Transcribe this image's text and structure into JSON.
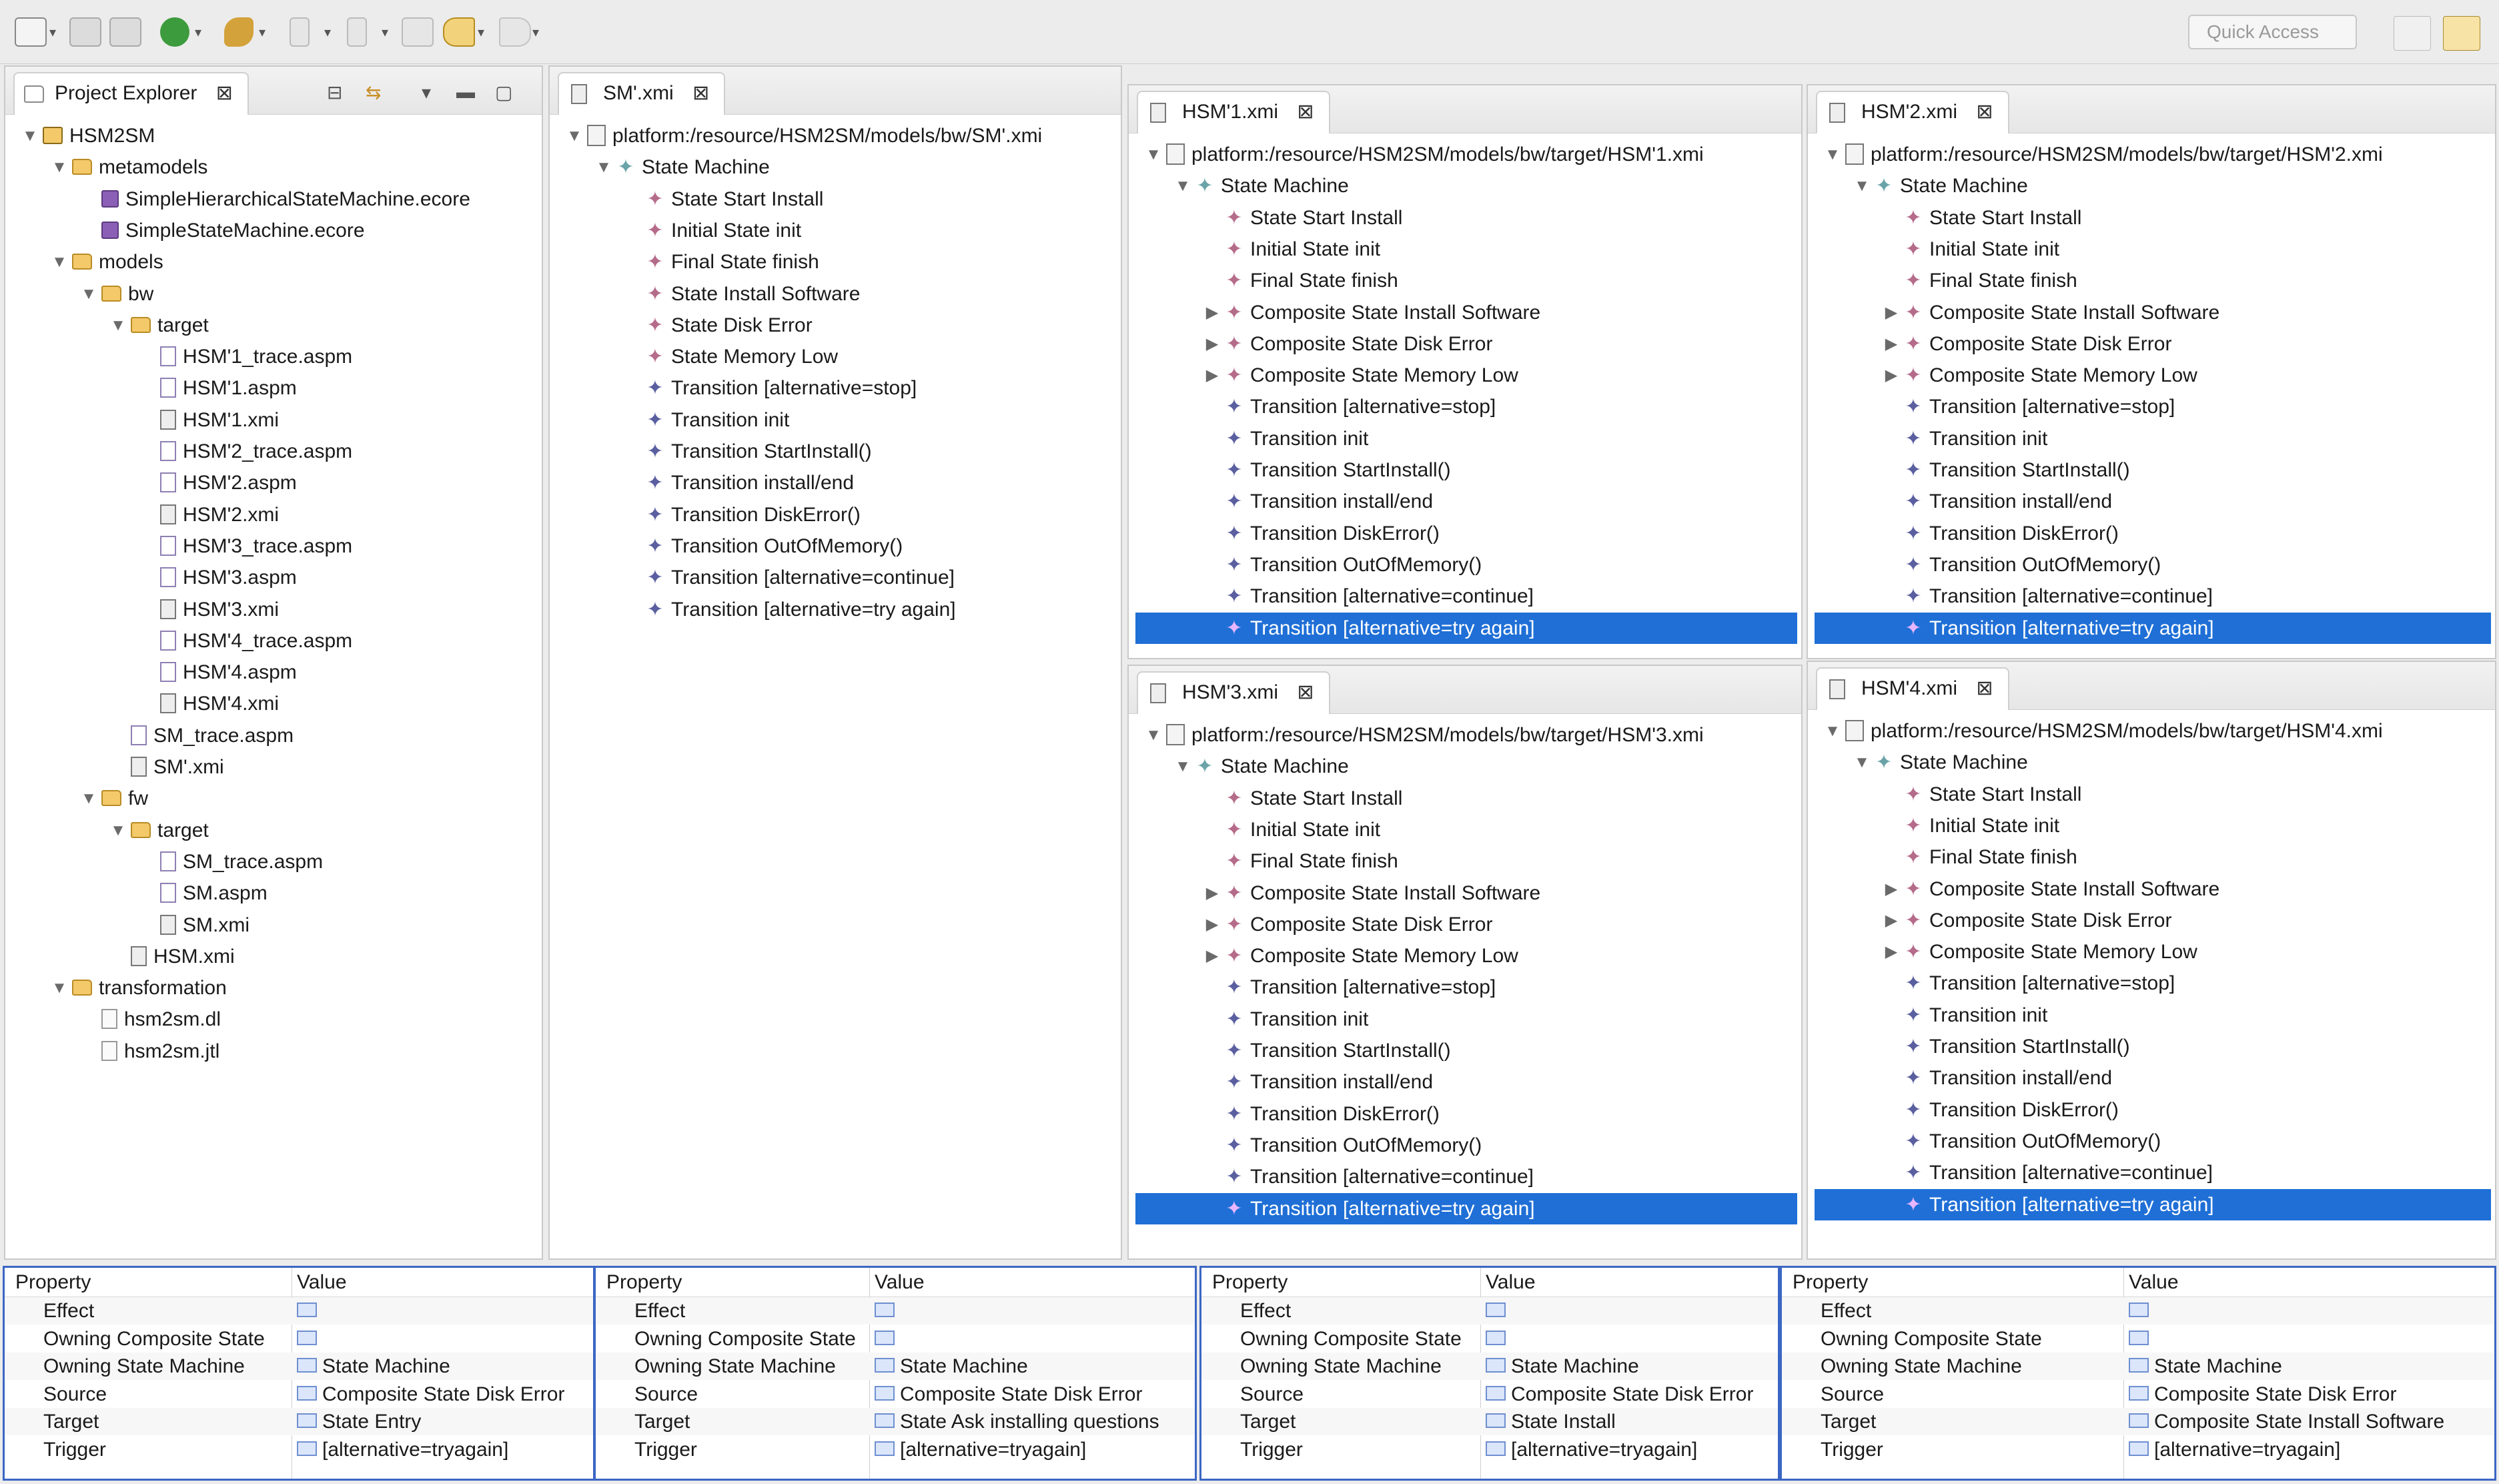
{
  "toolbar": {
    "quick_access_placeholder": "Quick Access"
  },
  "project_explorer": {
    "title": "Project Explorer",
    "items": [
      {
        "label": "HSM2SM",
        "icon": "project-folder-icon",
        "depth": 0,
        "expanded": true
      },
      {
        "label": "metamodels",
        "icon": "folder-icon",
        "depth": 1,
        "expanded": true
      },
      {
        "label": "SimpleHierarchicalStateMachine.ecore",
        "icon": "ecore-file-icon",
        "depth": 2
      },
      {
        "label": "SimpleStateMachine.ecore",
        "icon": "ecore-file-icon",
        "depth": 2
      },
      {
        "label": "models",
        "icon": "folder-icon",
        "depth": 1,
        "expanded": true
      },
      {
        "label": "bw",
        "icon": "folder-icon",
        "depth": 2,
        "expanded": true
      },
      {
        "label": "target",
        "icon": "folder-icon",
        "depth": 3,
        "expanded": true
      },
      {
        "label": "HSM'1_trace.aspm",
        "icon": "aspm-file-icon",
        "depth": 4
      },
      {
        "label": "HSM'1.aspm",
        "icon": "aspm-file-icon",
        "depth": 4
      },
      {
        "label": "HSM'1.xmi",
        "icon": "xmi-file-icon",
        "depth": 4
      },
      {
        "label": "HSM'2_trace.aspm",
        "icon": "aspm-file-icon",
        "depth": 4
      },
      {
        "label": "HSM'2.aspm",
        "icon": "aspm-file-icon",
        "depth": 4
      },
      {
        "label": "HSM'2.xmi",
        "icon": "xmi-file-icon",
        "depth": 4
      },
      {
        "label": "HSM'3_trace.aspm",
        "icon": "aspm-file-icon",
        "depth": 4
      },
      {
        "label": "HSM'3.aspm",
        "icon": "aspm-file-icon",
        "depth": 4
      },
      {
        "label": "HSM'3.xmi",
        "icon": "xmi-file-icon",
        "depth": 4
      },
      {
        "label": "HSM'4_trace.aspm",
        "icon": "aspm-file-icon",
        "depth": 4
      },
      {
        "label": "HSM'4.aspm",
        "icon": "aspm-file-icon",
        "depth": 4
      },
      {
        "label": "HSM'4.xmi",
        "icon": "xmi-file-icon",
        "depth": 4
      },
      {
        "label": "SM_trace.aspm",
        "icon": "aspm-file-icon",
        "depth": 3
      },
      {
        "label": "SM'.xmi",
        "icon": "xmi-file-icon",
        "depth": 3
      },
      {
        "label": "fw",
        "icon": "folder-icon",
        "depth": 2,
        "expanded": true
      },
      {
        "label": "target",
        "icon": "folder-icon",
        "depth": 3,
        "expanded": true
      },
      {
        "label": "SM_trace.aspm",
        "icon": "aspm-file-icon",
        "depth": 4
      },
      {
        "label": "SM.aspm",
        "icon": "aspm-file-icon",
        "depth": 4
      },
      {
        "label": "SM.xmi",
        "icon": "xmi-file-icon",
        "depth": 4
      },
      {
        "label": "HSM.xmi",
        "icon": "xmi-file-icon",
        "depth": 3
      },
      {
        "label": "transformation",
        "icon": "folder-icon",
        "depth": 1,
        "expanded": true
      },
      {
        "label": "hsm2sm.dl",
        "icon": "text-file-icon",
        "depth": 2
      },
      {
        "label": "hsm2sm.jtl",
        "icon": "text-file-icon",
        "depth": 2
      }
    ]
  },
  "editors": {
    "sm": {
      "tab_label": "SM'.xmi",
      "resource": "platform:/resource/HSM2SM/models/bw/SM'.xmi",
      "root": "State Machine",
      "items": [
        {
          "label": "State Start Install",
          "kind": "state"
        },
        {
          "label": "Initial State init",
          "kind": "state"
        },
        {
          "label": "Final State finish",
          "kind": "state"
        },
        {
          "label": "State Install Software",
          "kind": "state"
        },
        {
          "label": "State Disk Error",
          "kind": "state"
        },
        {
          "label": "State Memory Low",
          "kind": "state"
        },
        {
          "label": "Transition [alternative=stop]",
          "kind": "trans"
        },
        {
          "label": "Transition init",
          "kind": "trans"
        },
        {
          "label": "Transition StartInstall()",
          "kind": "trans"
        },
        {
          "label": "Transition install/end",
          "kind": "trans"
        },
        {
          "label": "Transition DiskError()",
          "kind": "trans"
        },
        {
          "label": "Transition OutOfMemory()",
          "kind": "trans"
        },
        {
          "label": "Transition [alternative=continue]",
          "kind": "trans"
        },
        {
          "label": "Transition [alternative=try again]",
          "kind": "trans"
        }
      ]
    },
    "hsm1": {
      "tab_label": "HSM'1.xmi",
      "resource": "platform:/resource/HSM2SM/models/bw/target/HSM'1.xmi",
      "root": "State Machine",
      "items": [
        {
          "label": "State Start Install",
          "kind": "state"
        },
        {
          "label": "Initial State init",
          "kind": "state"
        },
        {
          "label": "Final State finish",
          "kind": "state"
        },
        {
          "label": "Composite State Install Software",
          "kind": "state",
          "collapsed": true
        },
        {
          "label": "Composite State Disk Error",
          "kind": "state",
          "collapsed": true
        },
        {
          "label": "Composite State Memory Low",
          "kind": "state",
          "collapsed": true
        },
        {
          "label": "Transition [alternative=stop]",
          "kind": "trans"
        },
        {
          "label": "Transition init",
          "kind": "trans"
        },
        {
          "label": "Transition StartInstall()",
          "kind": "trans"
        },
        {
          "label": "Transition install/end",
          "kind": "trans"
        },
        {
          "label": "Transition DiskError()",
          "kind": "trans"
        },
        {
          "label": "Transition OutOfMemory()",
          "kind": "trans"
        },
        {
          "label": "Transition [alternative=continue]",
          "kind": "trans"
        },
        {
          "label": "Transition [alternative=try again]",
          "kind": "trans",
          "selected": true
        }
      ]
    },
    "hsm2": {
      "tab_label": "HSM'2.xmi",
      "resource": "platform:/resource/HSM2SM/models/bw/target/HSM'2.xmi",
      "root": "State Machine",
      "items": [
        {
          "label": "State Start Install",
          "kind": "state"
        },
        {
          "label": "Initial State init",
          "kind": "state"
        },
        {
          "label": "Final State finish",
          "kind": "state"
        },
        {
          "label": "Composite State Install Software",
          "kind": "state",
          "collapsed": true
        },
        {
          "label": "Composite State Disk Error",
          "kind": "state",
          "collapsed": true
        },
        {
          "label": "Composite State Memory Low",
          "kind": "state",
          "collapsed": true
        },
        {
          "label": "Transition [alternative=stop]",
          "kind": "trans"
        },
        {
          "label": "Transition init",
          "kind": "trans"
        },
        {
          "label": "Transition StartInstall()",
          "kind": "trans"
        },
        {
          "label": "Transition install/end",
          "kind": "trans"
        },
        {
          "label": "Transition DiskError()",
          "kind": "trans"
        },
        {
          "label": "Transition OutOfMemory()",
          "kind": "trans"
        },
        {
          "label": "Transition [alternative=continue]",
          "kind": "trans"
        },
        {
          "label": "Transition [alternative=try again]",
          "kind": "trans",
          "selected": true
        }
      ]
    },
    "hsm3": {
      "tab_label": "HSM'3.xmi",
      "resource": "platform:/resource/HSM2SM/models/bw/target/HSM'3.xmi",
      "root": "State Machine",
      "items": [
        {
          "label": "State Start Install",
          "kind": "state"
        },
        {
          "label": "Initial State init",
          "kind": "state"
        },
        {
          "label": "Final State finish",
          "kind": "state"
        },
        {
          "label": "Composite State Install Software",
          "kind": "state",
          "collapsed": true
        },
        {
          "label": "Composite State Disk Error",
          "kind": "state",
          "collapsed": true
        },
        {
          "label": "Composite State Memory Low",
          "kind": "state",
          "collapsed": true
        },
        {
          "label": "Transition [alternative=stop]",
          "kind": "trans"
        },
        {
          "label": "Transition init",
          "kind": "trans"
        },
        {
          "label": "Transition StartInstall()",
          "kind": "trans"
        },
        {
          "label": "Transition install/end",
          "kind": "trans"
        },
        {
          "label": "Transition DiskError()",
          "kind": "trans"
        },
        {
          "label": "Transition OutOfMemory()",
          "kind": "trans"
        },
        {
          "label": "Transition [alternative=continue]",
          "kind": "trans"
        },
        {
          "label": "Transition [alternative=try again]",
          "kind": "trans",
          "selected": true
        }
      ]
    },
    "hsm4": {
      "tab_label": "HSM'4.xmi",
      "resource": "platform:/resource/HSM2SM/models/bw/target/HSM'4.xmi",
      "root": "State Machine",
      "items": [
        {
          "label": "State Start Install",
          "kind": "state"
        },
        {
          "label": "Initial State init",
          "kind": "state"
        },
        {
          "label": "Final State finish",
          "kind": "state"
        },
        {
          "label": "Composite State Install Software",
          "kind": "state",
          "collapsed": true
        },
        {
          "label": "Composite State Disk Error",
          "kind": "state",
          "collapsed": true
        },
        {
          "label": "Composite State Memory Low",
          "kind": "state",
          "collapsed": true
        },
        {
          "label": "Transition [alternative=stop]",
          "kind": "trans"
        },
        {
          "label": "Transition init",
          "kind": "trans"
        },
        {
          "label": "Transition StartInstall()",
          "kind": "trans"
        },
        {
          "label": "Transition install/end",
          "kind": "trans"
        },
        {
          "label": "Transition DiskError()",
          "kind": "trans"
        },
        {
          "label": "Transition OutOfMemory()",
          "kind": "trans"
        },
        {
          "label": "Transition [alternative=continue]",
          "kind": "trans"
        },
        {
          "label": "Transition [alternative=try again]",
          "kind": "trans",
          "selected": true
        }
      ]
    }
  },
  "properties": {
    "header_property": "Property",
    "header_value": "Value",
    "tables": [
      {
        "rows": [
          {
            "name": "Effect",
            "value": ""
          },
          {
            "name": "Owning Composite State",
            "value": ""
          },
          {
            "name": "Owning State Machine",
            "value": "State Machine"
          },
          {
            "name": "Source",
            "value": "Composite State Disk Error"
          },
          {
            "name": "Target",
            "value": "State Entry"
          },
          {
            "name": "Trigger",
            "value": "[alternative=tryagain]"
          }
        ]
      },
      {
        "rows": [
          {
            "name": "Effect",
            "value": ""
          },
          {
            "name": "Owning Composite State",
            "value": ""
          },
          {
            "name": "Owning State Machine",
            "value": "State Machine"
          },
          {
            "name": "Source",
            "value": "Composite State Disk Error"
          },
          {
            "name": "Target",
            "value": "State Ask installing questions"
          },
          {
            "name": "Trigger",
            "value": "[alternative=tryagain]"
          }
        ]
      },
      {
        "rows": [
          {
            "name": "Effect",
            "value": ""
          },
          {
            "name": "Owning Composite State",
            "value": ""
          },
          {
            "name": "Owning State Machine",
            "value": "State Machine"
          },
          {
            "name": "Source",
            "value": "Composite State Disk Error"
          },
          {
            "name": "Target",
            "value": "State Install"
          },
          {
            "name": "Trigger",
            "value": "[alternative=tryagain]"
          }
        ]
      },
      {
        "rows": [
          {
            "name": "Effect",
            "value": ""
          },
          {
            "name": "Owning Composite State",
            "value": ""
          },
          {
            "name": "Owning State Machine",
            "value": "State Machine"
          },
          {
            "name": "Source",
            "value": "Composite State Disk Error"
          },
          {
            "name": "Target",
            "value": "Composite State Install Software"
          },
          {
            "name": "Trigger",
            "value": "[alternative=tryagain]"
          }
        ]
      }
    ]
  }
}
